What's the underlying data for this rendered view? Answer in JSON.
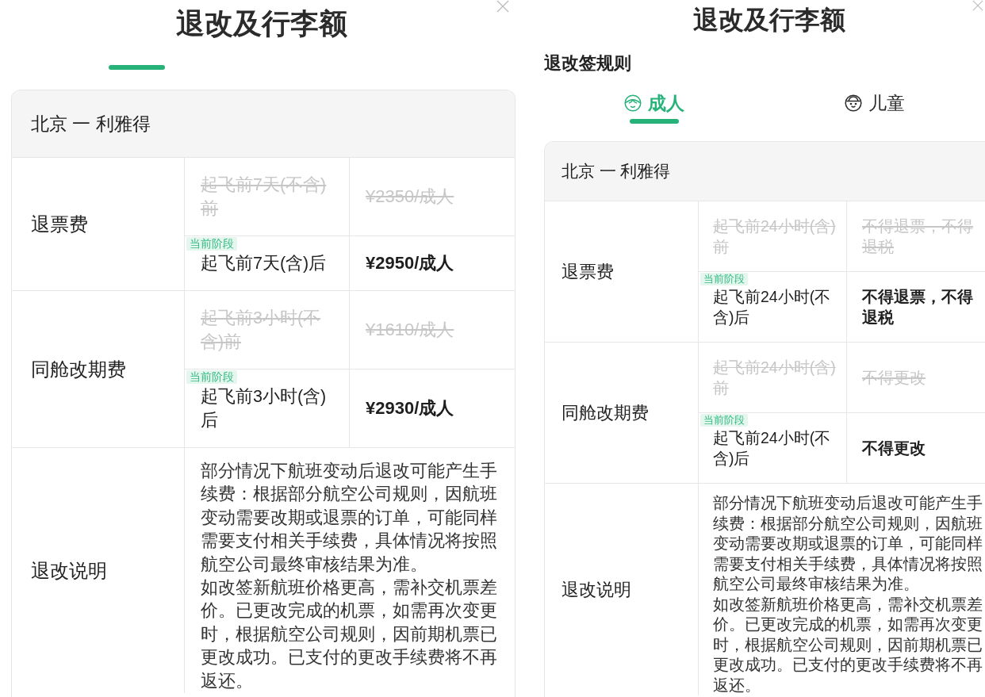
{
  "panels": [
    {
      "title": "退改及行李额",
      "active_tab_indicator": true,
      "route": "北京 一 利雅得",
      "rules": [
        {
          "label": "退票费",
          "stages": [
            {
              "condition": "起飞前7天(不含)前",
              "fee": "¥2350/成人",
              "current": false
            },
            {
              "badge": "当前阶段",
              "condition": "起飞前7天(含)后",
              "fee": "¥2950/成人",
              "current": true
            }
          ]
        },
        {
          "label": "同舱改期费",
          "stages": [
            {
              "condition": "起飞前3小时(不含)前",
              "fee": "¥1610/成人",
              "current": false
            },
            {
              "badge": "当前阶段",
              "condition": "起飞前3小时(含)后",
              "fee": "¥2930/成人",
              "current": true
            }
          ]
        }
      ],
      "notes": {
        "label": "退改说明",
        "paragraphs": [
          "部分情况下航班变动后退改可能产生手续费：根据部分航空公司规则，因航班变动需要改期或退票的订单，可能同样需要支付相关手续费，具体情况将按照航空公司最终审核结果为准。",
          "如改签新航班价格更高，需补交机票差价。已更改完成的机票，如需再次变更时，根据航空公司规则，因前期机票已更改成功。已支付的更改手续费将不再返还。"
        ]
      }
    },
    {
      "title": "退改及行李额",
      "section_title": "退改签规则",
      "passenger_tabs": [
        {
          "label": "成人",
          "selected": true
        },
        {
          "label": "儿童",
          "selected": false
        }
      ],
      "route": "北京 一 利雅得",
      "rules": [
        {
          "label": "退票费",
          "stages": [
            {
              "condition": "起飞前24小时(含)前",
              "fee": "不得退票，不得退税",
              "current": false
            },
            {
              "badge": "当前阶段",
              "condition": "起飞前24小时(不含)后",
              "fee": "不得退票，不得退税",
              "current": true
            }
          ]
        },
        {
          "label": "同舱改期费",
          "stages": [
            {
              "condition": "起飞前24小时(含)前",
              "fee": "不得更改",
              "current": false
            },
            {
              "badge": "当前阶段",
              "condition": "起飞前24小时(不含)后",
              "fee": "不得更改",
              "current": true
            }
          ]
        }
      ],
      "notes": {
        "label": "退改说明",
        "paragraphs": [
          "部分情况下航班变动后退改可能产生手续费：根据部分航空公司规则，因航班变动需要改期或退票的订单，可能同样需要支付相关手续费，具体情况将按照航空公司最终审核结果为准。",
          "如改签新航班价格更高，需补交机票差价。已更改完成的机票，如需再次变更时，根据航空公司规则，因前期机票已更改成功。已支付的更改手续费将不再返还。"
        ]
      }
    }
  ]
}
